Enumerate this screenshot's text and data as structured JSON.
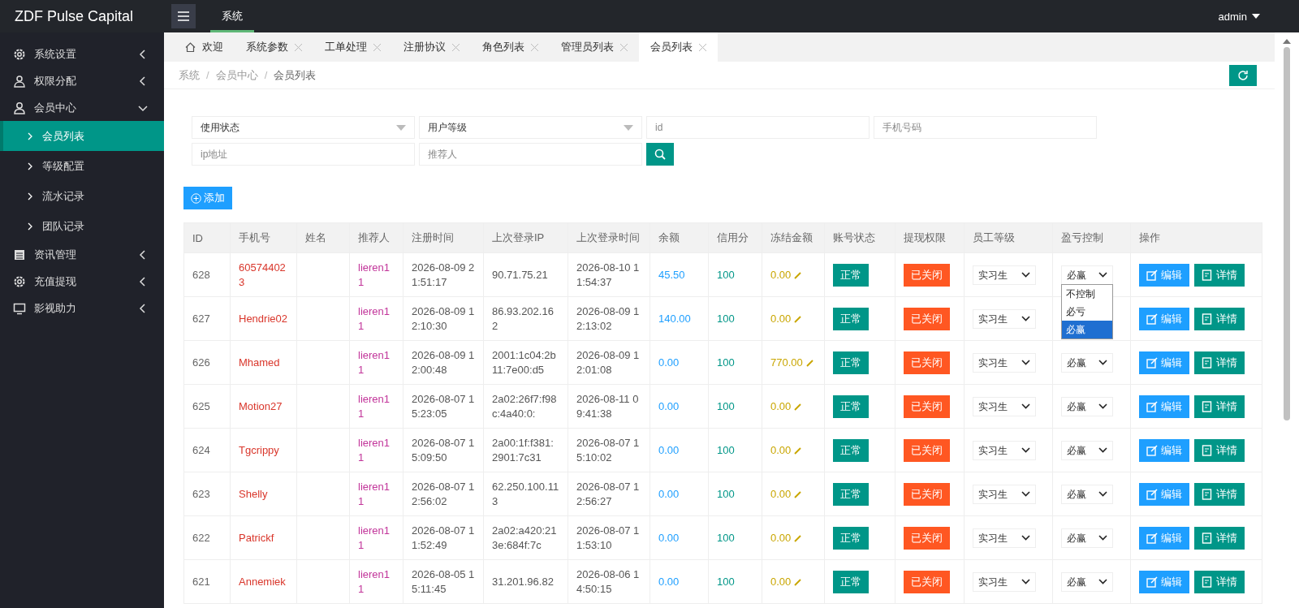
{
  "header": {
    "brand": "ZDF Pulse Capital",
    "nav": [
      {
        "label": "系统",
        "selected": true
      }
    ],
    "user": "admin"
  },
  "sidebar": {
    "items": [
      {
        "label": "系统设置",
        "expanded": false
      },
      {
        "label": "权限分配",
        "expanded": false
      },
      {
        "label": "会员中心",
        "expanded": true,
        "children": [
          {
            "label": "会员列表",
            "selected": true
          },
          {
            "label": "等级配置",
            "selected": false
          },
          {
            "label": "流水记录",
            "selected": false
          },
          {
            "label": "团队记录",
            "selected": false
          }
        ]
      },
      {
        "label": "资讯管理",
        "expanded": false
      },
      {
        "label": "充值提现",
        "expanded": false
      },
      {
        "label": "影视助力",
        "expanded": false
      }
    ]
  },
  "tabs": [
    {
      "label": "欢迎",
      "kind": "home",
      "selected": false
    },
    {
      "label": "系统参数",
      "kind": "closable",
      "selected": false
    },
    {
      "label": "工单处理",
      "kind": "closable",
      "selected": false
    },
    {
      "label": "注册协议",
      "kind": "closable",
      "selected": false
    },
    {
      "label": "角色列表",
      "kind": "closable",
      "selected": false
    },
    {
      "label": "管理员列表",
      "kind": "closable",
      "selected": false
    },
    {
      "label": "会员列表",
      "kind": "closable",
      "selected": true
    }
  ],
  "breadcrumb": [
    {
      "kind": "link",
      "label": "系统"
    },
    {
      "kind": "separator",
      "label": "/"
    },
    {
      "kind": "link",
      "label": "会员中心"
    },
    {
      "kind": "separator",
      "label": "/"
    },
    {
      "kind": "current",
      "label": "会员列表"
    }
  ],
  "filters": [
    {
      "kind": "select",
      "value": "使用状态"
    },
    {
      "kind": "select",
      "value": "用户等级"
    },
    {
      "kind": "input",
      "placeholder": "id"
    },
    {
      "kind": "input",
      "placeholder": "手机号码"
    },
    {
      "kind": "input",
      "placeholder": "ip地址"
    },
    {
      "kind": "input",
      "placeholder": "推荐人"
    },
    {
      "kind": "search"
    }
  ],
  "add_button": "添加",
  "table": {
    "columns": [
      "ID",
      "手机号",
      "姓名",
      "推荐人",
      "注册时间",
      "上次登录IP",
      "上次登录时间",
      "余额",
      "信用分",
      "冻结金额",
      "账号状态",
      "提现权限",
      "员工等级",
      "盈亏控制",
      "操作"
    ],
    "rows": [
      {
        "id": "628",
        "phone": "605744023",
        "referrer": "lieren11",
        "registered": "2026-08-09 21:51:17",
        "last_ip": "90.71.75.21",
        "last_login": "2026-08-10 11:54:37",
        "balance": "45.50",
        "credit": "100",
        "frozen": "0.00",
        "status": "正常",
        "withdraw": "已关闭",
        "staff_level": "实习生",
        "profit_control": "必赢",
        "dropdown": {
          "options": [
            {
              "label": "不控制",
              "selected": false
            },
            {
              "label": "必亏",
              "selected": false
            },
            {
              "label": "必赢",
              "selected": true
            }
          ]
        },
        "actions": [
          "编辑",
          "详情"
        ]
      },
      {
        "id": "627",
        "phone": "Hendrie02",
        "referrer": "lieren11",
        "registered": "2026-08-09 12:10:30",
        "last_ip": "86.93.202.162",
        "last_login": "2026-08-09 12:13:02",
        "balance": "140.00",
        "credit": "100",
        "frozen": "0.00",
        "status": "正常",
        "withdraw": "已关闭",
        "staff_level": "实习生",
        "actions": [
          "编辑",
          "详情"
        ]
      },
      {
        "id": "626",
        "phone": "Mhamed",
        "referrer": "lieren11",
        "registered": "2026-08-09 12:00:48",
        "last_ip": "2001:1c04:2b11:7e00:d5",
        "last_login": "2026-08-09 12:01:08",
        "balance": "0.00",
        "credit": "100",
        "frozen": "770.00",
        "status": "正常",
        "withdraw": "已关闭",
        "staff_level": "实习生",
        "profit_control": "必赢",
        "actions": [
          "编辑",
          "详情"
        ]
      },
      {
        "id": "625",
        "phone": "Motion27",
        "referrer": "lieren11",
        "registered": "2026-08-07 15:23:05",
        "last_ip": "2a02:26f7:f98c:4a40:0:",
        "last_login": "2026-08-11 09:41:38",
        "balance": "0.00",
        "credit": "100",
        "frozen": "0.00",
        "status": "正常",
        "withdraw": "已关闭",
        "staff_level": "实习生",
        "profit_control": "必赢",
        "actions": [
          "编辑",
          "详情"
        ]
      },
      {
        "id": "624",
        "phone": "Tgcrippy",
        "referrer": "lieren11",
        "registered": "2026-08-07 15:09:50",
        "last_ip": "2a00:1f:f381:2901:7c31",
        "last_login": "2026-08-07 15:10:02",
        "balance": "0.00",
        "credit": "100",
        "frozen": "0.00",
        "status": "正常",
        "withdraw": "已关闭",
        "staff_level": "实习生",
        "profit_control": "必赢",
        "actions": [
          "编辑",
          "详情"
        ]
      },
      {
        "id": "623",
        "phone": "Shelly",
        "referrer": "lieren11",
        "registered": "2026-08-07 12:56:02",
        "last_ip": "62.250.100.113",
        "last_login": "2026-08-07 12:56:27",
        "balance": "0.00",
        "credit": "100",
        "frozen": "0.00",
        "status": "正常",
        "withdraw": "已关闭",
        "staff_level": "实习生",
        "profit_control": "必赢",
        "actions": [
          "编辑",
          "详情"
        ]
      },
      {
        "id": "622",
        "phone": "Patrickf",
        "referrer": "lieren11",
        "registered": "2026-08-07 11:52:49",
        "last_ip": "2a02:a420:213e:684f:7c",
        "last_login": "2026-08-07 11:53:10",
        "balance": "0.00",
        "credit": "100",
        "frozen": "0.00",
        "status": "正常",
        "withdraw": "已关闭",
        "staff_level": "实习生",
        "profit_control": "必赢",
        "actions": [
          "编辑",
          "详情"
        ]
      },
      {
        "id": "621",
        "phone": "Annemiek",
        "referrer": "lieren11",
        "registered": "2026-08-05 15:11:45",
        "last_ip": "31.201.96.82",
        "last_login": "2026-08-06 14:50:15",
        "balance": "0.00",
        "credit": "100",
        "frozen": "0.00",
        "status": "正常",
        "withdraw": "已关闭",
        "staff_level": "实习生",
        "profit_control": "必赢",
        "actions": [
          "编辑",
          "详情"
        ]
      }
    ]
  }
}
